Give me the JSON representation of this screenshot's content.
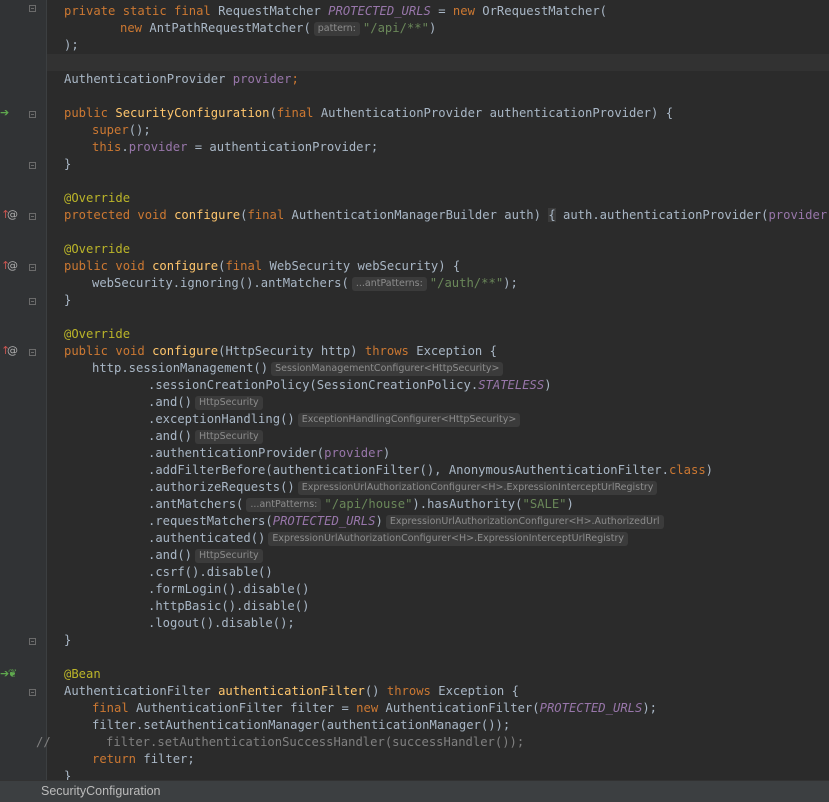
{
  "breadcrumb": "SecurityConfiguration",
  "colors": {
    "background": "#2b2b2b",
    "keyword": "#cc7832",
    "method": "#ffc66d",
    "field": "#9876aa",
    "string": "#6a8759",
    "annotation": "#bbb529"
  },
  "code": {
    "l1": {
      "a": "private static final",
      "b": " RequestMatcher ",
      "c": "PROTECTED_URLS",
      "d": " = ",
      "e": "new",
      "f": " OrRequestMatcher("
    },
    "l2": {
      "a": "new",
      "b": " AntPathRequestMatcher(",
      "hint": "pattern:",
      "s": "\"/api/**\"",
      "c": ")"
    },
    "l3": {
      "a": ");"
    },
    "l4": {
      "a": "AuthenticationProvider ",
      "b": "provider",
      "c": ";"
    },
    "l5": {
      "a": "public",
      "b": " ",
      "c": "SecurityConfiguration",
      "d": "(",
      "e": "final",
      "f": " AuthenticationProvider authenticationProvider) {"
    },
    "l6": {
      "a": "super",
      "b": "();"
    },
    "l7": {
      "a": "this",
      "b": ".",
      "c": "provider",
      "d": " = authenticationProvider;"
    },
    "l8": {
      "a": "}"
    },
    "l9": {
      "a": "@Override"
    },
    "l10": {
      "a": "protected void",
      "b": " ",
      "c": "configure",
      "d": "(",
      "e": "final",
      "f": " AuthenticationManagerBuilder auth) ",
      "g": "{",
      "h": " auth.authenticationProvider(",
      "i": "provider",
      "j": "); ",
      "k": "}"
    },
    "l11": {
      "a": "@Override"
    },
    "l12": {
      "a": "public void",
      "b": " ",
      "c": "configure",
      "d": "(",
      "e": "final",
      "f": " WebSecurity webSecurity) {"
    },
    "l13": {
      "a": "webSecurity.ignoring().antMatchers(",
      "hint": "...antPatterns:",
      "s": "\"/auth/**\"",
      "c": ");"
    },
    "l14": {
      "a": "}"
    },
    "l15": {
      "a": "@Override"
    },
    "l16": {
      "a": "public void",
      "b": " ",
      "c": "configure",
      "d": "(HttpSecurity http) ",
      "e": "throws",
      "f": " Exception {"
    },
    "l17": {
      "a": "http.sessionManagement()",
      "hint": "SessionManagementConfigurer<HttpSecurity>"
    },
    "l18": {
      "a": ".sessionCreationPolicy(SessionCreationPolicy.",
      "b": "STATELESS",
      "c": ")"
    },
    "l19": {
      "a": ".and()",
      "hint": "HttpSecurity"
    },
    "l20": {
      "a": ".exceptionHandling()",
      "hint": "ExceptionHandlingConfigurer<HttpSecurity>"
    },
    "l21": {
      "a": ".and()",
      "hint": "HttpSecurity"
    },
    "l22": {
      "a": ".authenticationProvider(",
      "b": "provider",
      "c": ")"
    },
    "l23": {
      "a": ".addFilterBefore(authenticationFilter(), AnonymousAuthenticationFilter.",
      "b": "class",
      "c": ")"
    },
    "l24": {
      "a": ".authorizeRequests()",
      "hint": "ExpressionUrlAuthorizationConfigurer<H>.ExpressionInterceptUrlRegistry"
    },
    "l25": {
      "a": ".antMatchers(",
      "hint": "...antPatterns:",
      "s": "\"/api/house\"",
      "b": ").hasAuthority(",
      "s2": "\"SALE\"",
      "c": ")"
    },
    "l26": {
      "a": ".requestMatchers(",
      "b": "PROTECTED_URLS",
      "c": ")",
      "hint": "ExpressionUrlAuthorizationConfigurer<H>.AuthorizedUrl"
    },
    "l27": {
      "a": ".authenticated()",
      "hint": "ExpressionUrlAuthorizationConfigurer<H>.ExpressionInterceptUrlRegistry"
    },
    "l28": {
      "a": ".and()",
      "hint": "HttpSecurity"
    },
    "l29": {
      "a": ".csrf().disable()"
    },
    "l30": {
      "a": ".formLogin().disable()"
    },
    "l31": {
      "a": ".httpBasic().disable()"
    },
    "l32": {
      "a": ".logout().disable();"
    },
    "l33": {
      "a": "}"
    },
    "l34": {
      "a": "@Bean"
    },
    "l35": {
      "a": "AuthenticationFilter ",
      "b": "authenticationFilter",
      "c": "() ",
      "d": "throws",
      "e": " Exception {"
    },
    "l36": {
      "a": "final",
      "b": " AuthenticationFilter filter = ",
      "c": "new",
      "d": " AuthenticationFilter(",
      "e": "PROTECTED_URLS",
      "f": ");"
    },
    "l37": {
      "a": "filter.setAuthenticationManager(authenticationManager());"
    },
    "l38": {
      "a": "//",
      "b": "filter.setAuthenticationSuccessHandler(successHandler());"
    },
    "l39": {
      "a": "return",
      "b": " filter;"
    },
    "l40": {
      "a": "}"
    }
  }
}
